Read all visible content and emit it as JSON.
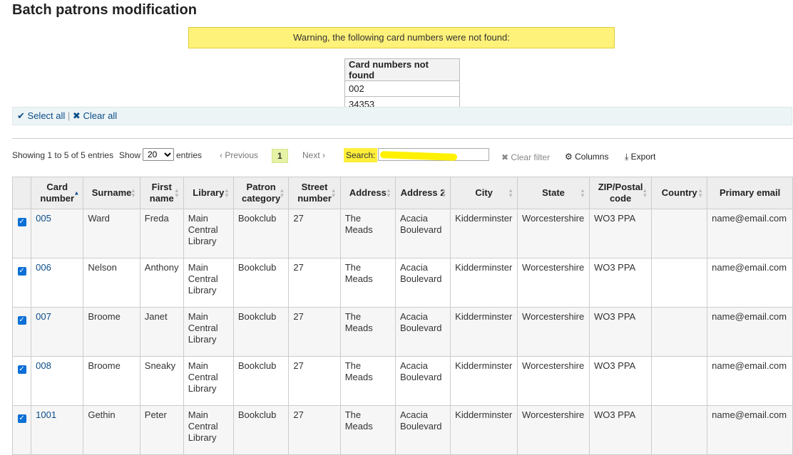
{
  "page": {
    "title": "Batch patrons modification"
  },
  "warning": {
    "text": "Warning, the following card numbers were not found:"
  },
  "not_found": {
    "header": "Card numbers not found",
    "items": [
      "002",
      "34353"
    ]
  },
  "select_bar": {
    "select_all": "Select all",
    "separator": "|",
    "clear_all": "Clear all"
  },
  "toolbar": {
    "showing": "Showing 1 to 5 of 5 entries",
    "show": "Show",
    "show_value": "20",
    "entries": "entries",
    "previous": "Previous",
    "current_page": "1",
    "next": "Next",
    "search_label": "Search:",
    "clear_filter": "Clear filter",
    "columns": "Columns",
    "export": "Export"
  },
  "table": {
    "headers": [
      "Card number",
      "Surname",
      "First name",
      "Library",
      "Patron category",
      "Street number",
      "Address",
      "Address 2",
      "City",
      "State",
      "ZIP/Postal code",
      "Country",
      "Primary email"
    ],
    "rows": [
      [
        "005",
        "Ward",
        "Freda",
        "Main Central Library",
        "Bookclub",
        "27",
        "The Meads",
        "Acacia Boulevard",
        "Kidderminster",
        "Worcestershire",
        "WO3 PPA",
        "",
        "name@email.com"
      ],
      [
        "006",
        "Nelson",
        "Anthony",
        "Main Central Library",
        "Bookclub",
        "27",
        "The Meads",
        "Acacia Boulevard",
        "Kidderminster",
        "Worcestershire",
        "WO3 PPA",
        "",
        "name@email.com"
      ],
      [
        "007",
        "Broome",
        "Janet",
        "Main Central Library",
        "Bookclub",
        "27",
        "The Meads",
        "Acacia Boulevard",
        "Kidderminster",
        "Worcestershire",
        "WO3 PPA",
        "",
        "name@email.com"
      ],
      [
        "008",
        "Broome",
        "Sneaky",
        "Main Central Library",
        "Bookclub",
        "27",
        "The Meads",
        "Acacia Boulevard",
        "Kidderminster",
        "Worcestershire",
        "WO3 PPA",
        "",
        "name@email.com"
      ],
      [
        "1001",
        "Gethin",
        "Peter",
        "Main Central Library",
        "Bookclub",
        "27",
        "The Meads",
        "Acacia Boulevard",
        "Kidderminster",
        "Worcestershire",
        "WO3 PPA",
        "",
        "name@email.com"
      ]
    ]
  },
  "colors": {
    "accent": "#0b4d88",
    "warning_bg": "#fff27a",
    "highlight": "#fff100"
  }
}
